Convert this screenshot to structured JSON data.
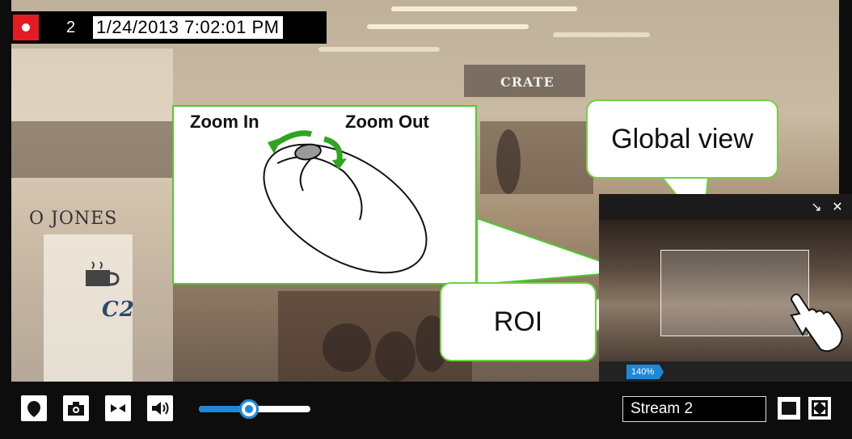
{
  "recording": {
    "stream_number": "2",
    "timestamp": "1/24/2013 7:02:01 PM"
  },
  "zoom_help": {
    "zoom_in_label": "Zoom In",
    "zoom_out_label": "Zoom Out"
  },
  "callouts": {
    "global_view": "Global view",
    "roi": "ROI"
  },
  "overview": {
    "minimize_glyph": "↘",
    "close_glyph": "✕",
    "zoom_level": "140%"
  },
  "scene_signs": {
    "left_sign": "O JONES",
    "cafe_sign": "C2",
    "top_sign": "CRATE"
  },
  "controls": {
    "volume_level": 0.45,
    "stream_value": "Stream 2"
  },
  "colors": {
    "record": "#e51b23",
    "accent": "#1e88d8",
    "callout_border": "#6fd141"
  }
}
